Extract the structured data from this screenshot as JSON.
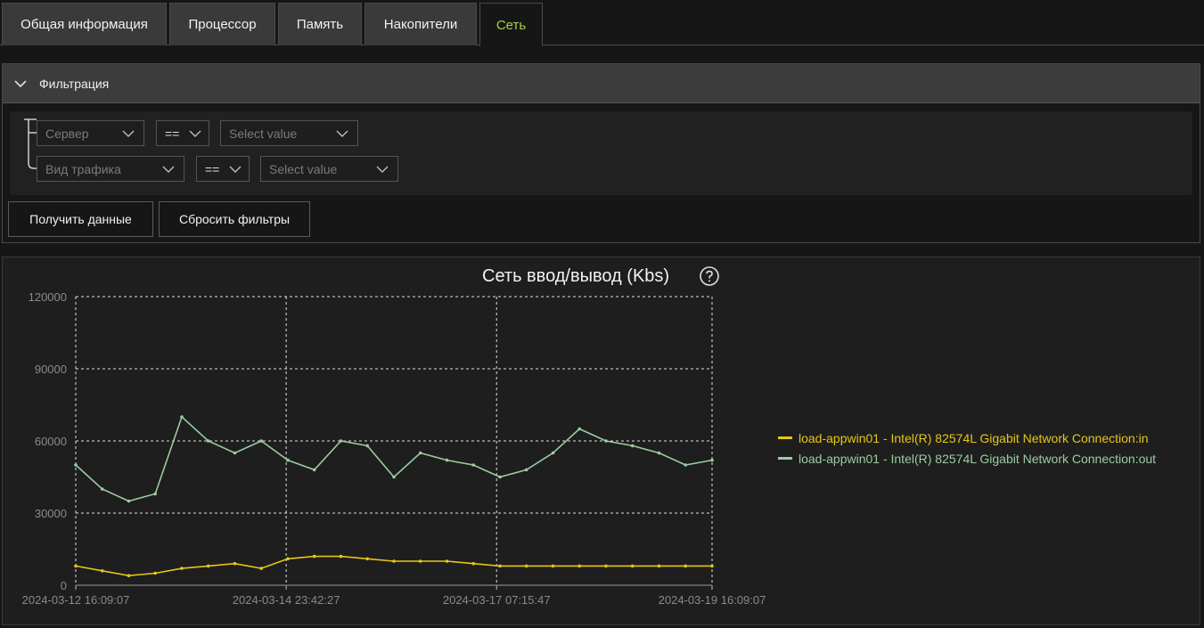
{
  "tabs": [
    {
      "label": "Общая информация",
      "active": false
    },
    {
      "label": "Процессор",
      "active": false
    },
    {
      "label": "Память",
      "active": false
    },
    {
      "label": "Накопители",
      "active": false
    },
    {
      "label": "Сеть",
      "active": true
    }
  ],
  "filter": {
    "title": "Фильтрация",
    "rows": [
      {
        "field": "Сервер",
        "operator": "==",
        "value_placeholder": "Select value"
      },
      {
        "field": "Вид трафика",
        "operator": "==",
        "value_placeholder": "Select value"
      }
    ],
    "get_data_label": "Получить данные",
    "reset_label": "Сбросить фильтры"
  },
  "colors": {
    "accent": "#a6d14a",
    "series_in": "#e6c619",
    "series_out": "#9ccca0"
  },
  "chart_data": {
    "type": "line",
    "title": "Сеть ввод/вывод (Kbs)",
    "ylim": [
      0,
      120000
    ],
    "yticks": [
      "0",
      "30000",
      "60000",
      "90000",
      "120000"
    ],
    "xticks": [
      "2024-03-12 16:09:07",
      "2024-03-14 23:42:27",
      "2024-03-17 07:15:47",
      "2024-03-19 16:09:07"
    ],
    "xlim": [
      "2024-03-12 16:09:07",
      "2024-03-19 16:09:07"
    ],
    "grid": true,
    "legend_position": "right",
    "series": [
      {
        "name": "load-appwin01 - Intel(R) 82574L Gigabit Network Connection:in",
        "color": "#e6c619",
        "x": [
          "2024-03-12 16:09",
          "2024-03-12 23:09",
          "2024-03-13 06:09",
          "2024-03-13 13:09",
          "2024-03-13 20:09",
          "2024-03-14 03:09",
          "2024-03-14 10:09",
          "2024-03-14 17:09",
          "2024-03-15 00:09",
          "2024-03-15 07:09",
          "2024-03-15 14:09",
          "2024-03-15 21:09",
          "2024-03-16 04:09",
          "2024-03-16 11:09",
          "2024-03-16 18:09",
          "2024-03-17 01:09",
          "2024-03-17 08:09",
          "2024-03-17 15:09",
          "2024-03-17 22:09",
          "2024-03-18 05:09",
          "2024-03-18 12:09",
          "2024-03-18 19:09",
          "2024-03-19 02:09",
          "2024-03-19 09:09",
          "2024-03-19 16:09"
        ],
        "values": [
          8000,
          6000,
          4000,
          5000,
          7000,
          8000,
          9000,
          7000,
          11000,
          12000,
          12000,
          11000,
          10000,
          10000,
          10000,
          9000,
          8000,
          8000,
          8000,
          8000,
          8000,
          8000,
          8000,
          8000,
          8000
        ]
      },
      {
        "name": "load-appwin01 - Intel(R) 82574L Gigabit Network Connection:out",
        "color": "#9ccca0",
        "x": [
          "2024-03-12 16:09",
          "2024-03-12 23:09",
          "2024-03-13 06:09",
          "2024-03-13 13:09",
          "2024-03-13 20:09",
          "2024-03-14 03:09",
          "2024-03-14 10:09",
          "2024-03-14 17:09",
          "2024-03-15 00:09",
          "2024-03-15 07:09",
          "2024-03-15 14:09",
          "2024-03-15 21:09",
          "2024-03-16 04:09",
          "2024-03-16 11:09",
          "2024-03-16 18:09",
          "2024-03-17 01:09",
          "2024-03-17 08:09",
          "2024-03-17 15:09",
          "2024-03-17 22:09",
          "2024-03-18 05:09",
          "2024-03-18 12:09",
          "2024-03-18 19:09",
          "2024-03-19 02:09",
          "2024-03-19 09:09",
          "2024-03-19 16:09"
        ],
        "values": [
          50000,
          40000,
          35000,
          38000,
          70000,
          60000,
          55000,
          60000,
          52000,
          48000,
          60000,
          58000,
          45000,
          55000,
          52000,
          50000,
          45000,
          48000,
          55000,
          65000,
          60000,
          58000,
          55000,
          50000,
          52000
        ]
      }
    ]
  }
}
